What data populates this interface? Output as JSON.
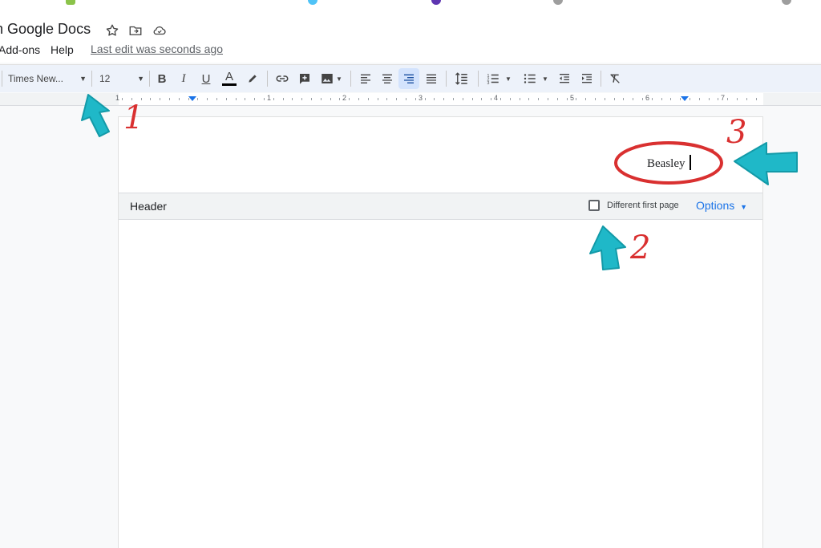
{
  "window": {
    "title": "n Google Docs",
    "last_edit": "Last edit was seconds ago"
  },
  "menu": {
    "items": [
      {
        "label": "Add-ons"
      },
      {
        "label": "Help"
      }
    ]
  },
  "toolbar": {
    "font": "Times New...",
    "size": "12",
    "active_alignment": "align-right",
    "buttons": [
      {
        "name": "bold",
        "glyph": "B"
      },
      {
        "name": "italic",
        "glyph": "I"
      },
      {
        "name": "underline",
        "glyph": "U"
      },
      {
        "name": "text-color",
        "glyph": "A"
      }
    ]
  },
  "ruler": {
    "labels": [
      "1",
      "1",
      "2",
      "3",
      "4",
      "5",
      "6",
      "7"
    ]
  },
  "document": {
    "header_text": "Beasley"
  },
  "header_bar": {
    "label": "Header",
    "different_first_page": "Different first page",
    "different_first_page_checked": false,
    "options": "Options"
  },
  "annotations": {
    "numbers": [
      "1",
      "2",
      "3"
    ],
    "arrow_color": "#1fb8c8",
    "number_color": "#d93030"
  },
  "colors": {
    "accent": "#1a73e8",
    "toolbar_bg": "#edf2fa",
    "active_button": "#d3e3fd"
  }
}
